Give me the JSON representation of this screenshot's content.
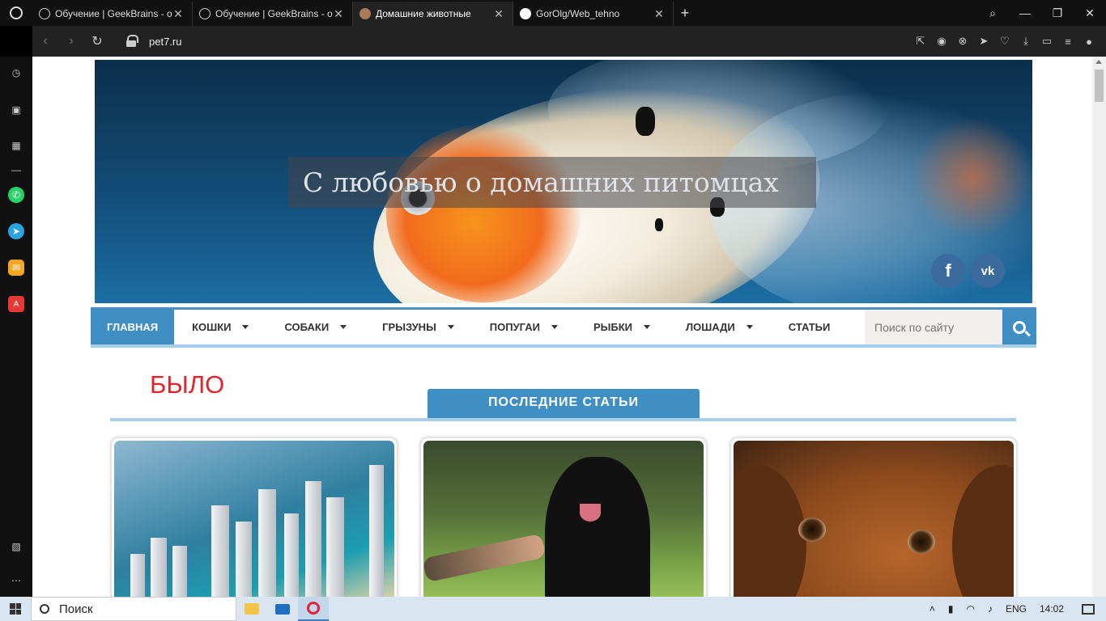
{
  "browser": {
    "tabs": [
      {
        "title": "Обучение | GeekBrains - о",
        "icon": "geekbrains-icon",
        "active": false
      },
      {
        "title": "Обучение | GeekBrains - о",
        "icon": "geekbrains-icon",
        "active": false
      },
      {
        "title": "Домашние животные",
        "icon": "pet-site-icon",
        "active": true
      },
      {
        "title": "GorOlg/Web_tehno",
        "icon": "github-icon",
        "active": false
      }
    ],
    "new_tab": "+",
    "url": "pet7.ru",
    "window_controls": [
      "search-icon",
      "minimize-icon",
      "restore-icon",
      "close-icon"
    ]
  },
  "site": {
    "banner_title": "С любовью о домашних питомцах",
    "social": {
      "facebook": "f",
      "vk": "vk"
    },
    "menu": [
      {
        "label": "ГЛАВНАЯ",
        "active": true,
        "dropdown": false
      },
      {
        "label": "КОШКИ",
        "active": false,
        "dropdown": true
      },
      {
        "label": "СОБАКИ",
        "active": false,
        "dropdown": true
      },
      {
        "label": "ГРЫЗУНЫ",
        "active": false,
        "dropdown": true
      },
      {
        "label": "ПОПУГАИ",
        "active": false,
        "dropdown": true
      },
      {
        "label": "РЫБКИ",
        "active": false,
        "dropdown": true
      },
      {
        "label": "ЛОШАДИ",
        "active": false,
        "dropdown": true
      },
      {
        "label": "СТАТЬИ",
        "active": false,
        "dropdown": false
      }
    ],
    "search_placeholder": "Поиск по сайту",
    "overlay_text": "БЫЛО",
    "section_title": "ПОСЛЕДНИЕ СТАТЬИ"
  },
  "taskbar": {
    "search_label": "Поиск",
    "language": "ENG",
    "time": "14:02"
  },
  "colors": {
    "accent": "#3f8ec4",
    "overlay_text": "#e22329",
    "menu_rule": "#a8cde6"
  }
}
